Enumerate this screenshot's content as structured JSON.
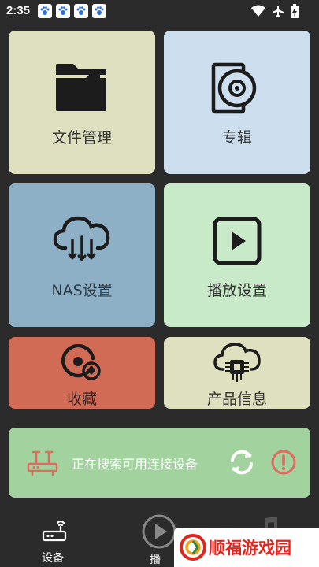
{
  "status_bar": {
    "time": "2:35",
    "notification_icons": [
      "paw-icon",
      "paw-icon",
      "paw-icon",
      "paw-icon"
    ],
    "system_icons": [
      "wifi-icon",
      "airplane-icon",
      "battery-charging-icon"
    ]
  },
  "tiles": [
    {
      "label": "文件管理",
      "icon": "folder-icon",
      "color": "#dfe0bf"
    },
    {
      "label": "专辑",
      "icon": "disc-icon",
      "color": "#cddfee"
    },
    {
      "label": "NAS设置",
      "icon": "cloud-download-icon",
      "color": "#8db0c6"
    },
    {
      "label": "播放设置",
      "icon": "play-icon",
      "color": "#c9eac8"
    },
    {
      "label": "收藏",
      "icon": "favorite-disc-icon",
      "color": "#d26b55"
    },
    {
      "label": "产品信息",
      "icon": "cloud-chip-icon",
      "color": "#dfe0bf"
    }
  ],
  "connection": {
    "status_text": "正在搜索可用连接设备",
    "icons": [
      "router-icon",
      "refresh-icon",
      "alert-icon"
    ],
    "color": "#a2d39f",
    "accent": "#e06b5e"
  },
  "bottom_nav": [
    {
      "label": "设备",
      "icon": "router-icon",
      "active": true
    },
    {
      "label": "播",
      "icon": "play-circle-icon",
      "active": false
    },
    {
      "label": "",
      "icon": "music-note-icon",
      "active": false
    }
  ],
  "watermark": {
    "text": "顺福游戏园",
    "color": "#e0261c"
  }
}
